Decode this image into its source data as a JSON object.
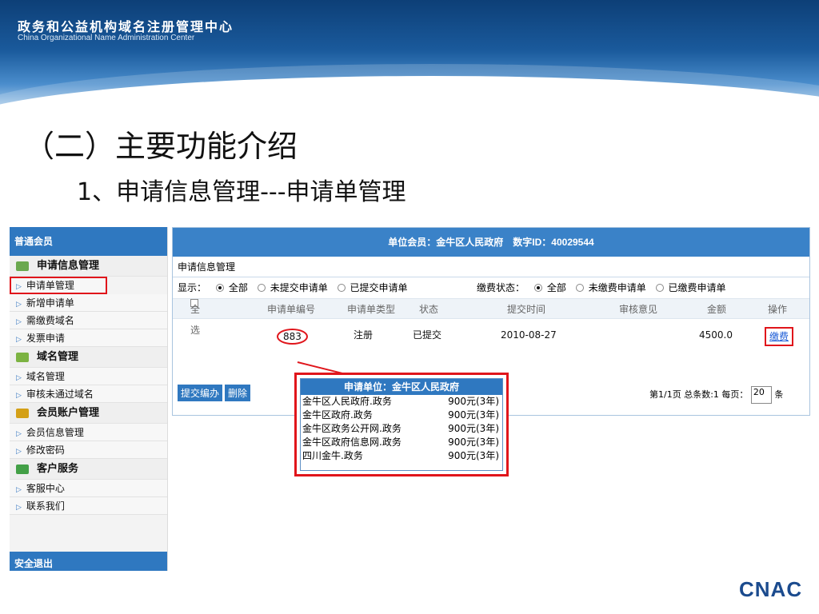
{
  "banner": {
    "cn": "政务和公益机构域名注册管理中心",
    "en": "China Organizational Name Administration Center"
  },
  "titles": {
    "main": "（二）主要功能介绍",
    "sub": "1、申请信息管理---申请单管理"
  },
  "sidebar": {
    "header": "普通会员",
    "sections": [
      {
        "title": "申请信息管理",
        "color": "#6aa84f",
        "items": [
          "申请单管理",
          "新增申请单",
          "需缴费域名",
          "发票申请"
        ]
      },
      {
        "title": "域名管理",
        "color": "#7cb342",
        "items": [
          "域名管理",
          "审核未通过域名"
        ]
      },
      {
        "title": "会员账户管理",
        "color": "#d4a017",
        "items": [
          "会员信息管理",
          "修改密码"
        ]
      },
      {
        "title": "客户服务",
        "color": "#43a047",
        "items": [
          "客服中心",
          "联系我们"
        ]
      }
    ],
    "footer": "安全退出"
  },
  "main": {
    "header": "单位会员：金牛区人民政府　数字ID：40029544",
    "breadcrumb": "申请信息管理",
    "filter": {
      "show_label": "显示：",
      "show_options": [
        "全部",
        "未提交申请单",
        "已提交申请单"
      ],
      "fee_label": "缴费状态：",
      "fee_options": [
        "全部",
        "未缴费申请单",
        "已缴费申请单"
      ]
    },
    "columns": [
      "全选",
      "申请单编号",
      "申请单类型",
      "状态",
      "提交时间",
      "审核意见",
      "金额",
      "操作"
    ],
    "row": {
      "id": "883",
      "type": "注册",
      "status": "已提交",
      "time": "2010-08-27",
      "opinion": "",
      "amount": "4500.0",
      "action": "缴费"
    },
    "buttons": {
      "submit": "提交编办",
      "delete": "删除"
    },
    "pager": {
      "text": "第1/1页 总条数:1 每页：",
      "per_page": "20",
      "unit": "条"
    }
  },
  "popup": {
    "title": "申请单位：金牛区人民政府",
    "rows": [
      {
        "domain": "金牛区人民政府.政务",
        "price": "900元(3年)"
      },
      {
        "domain": "金牛区政府.政务",
        "price": "900元(3年)"
      },
      {
        "domain": "金牛区政务公开网.政务",
        "price": "900元(3年)"
      },
      {
        "domain": "金牛区政府信息网.政务",
        "price": "900元(3年)"
      },
      {
        "domain": "四川金牛.政务",
        "price": "900元(3年)"
      }
    ]
  },
  "logo": {
    "text": "CNAC"
  }
}
